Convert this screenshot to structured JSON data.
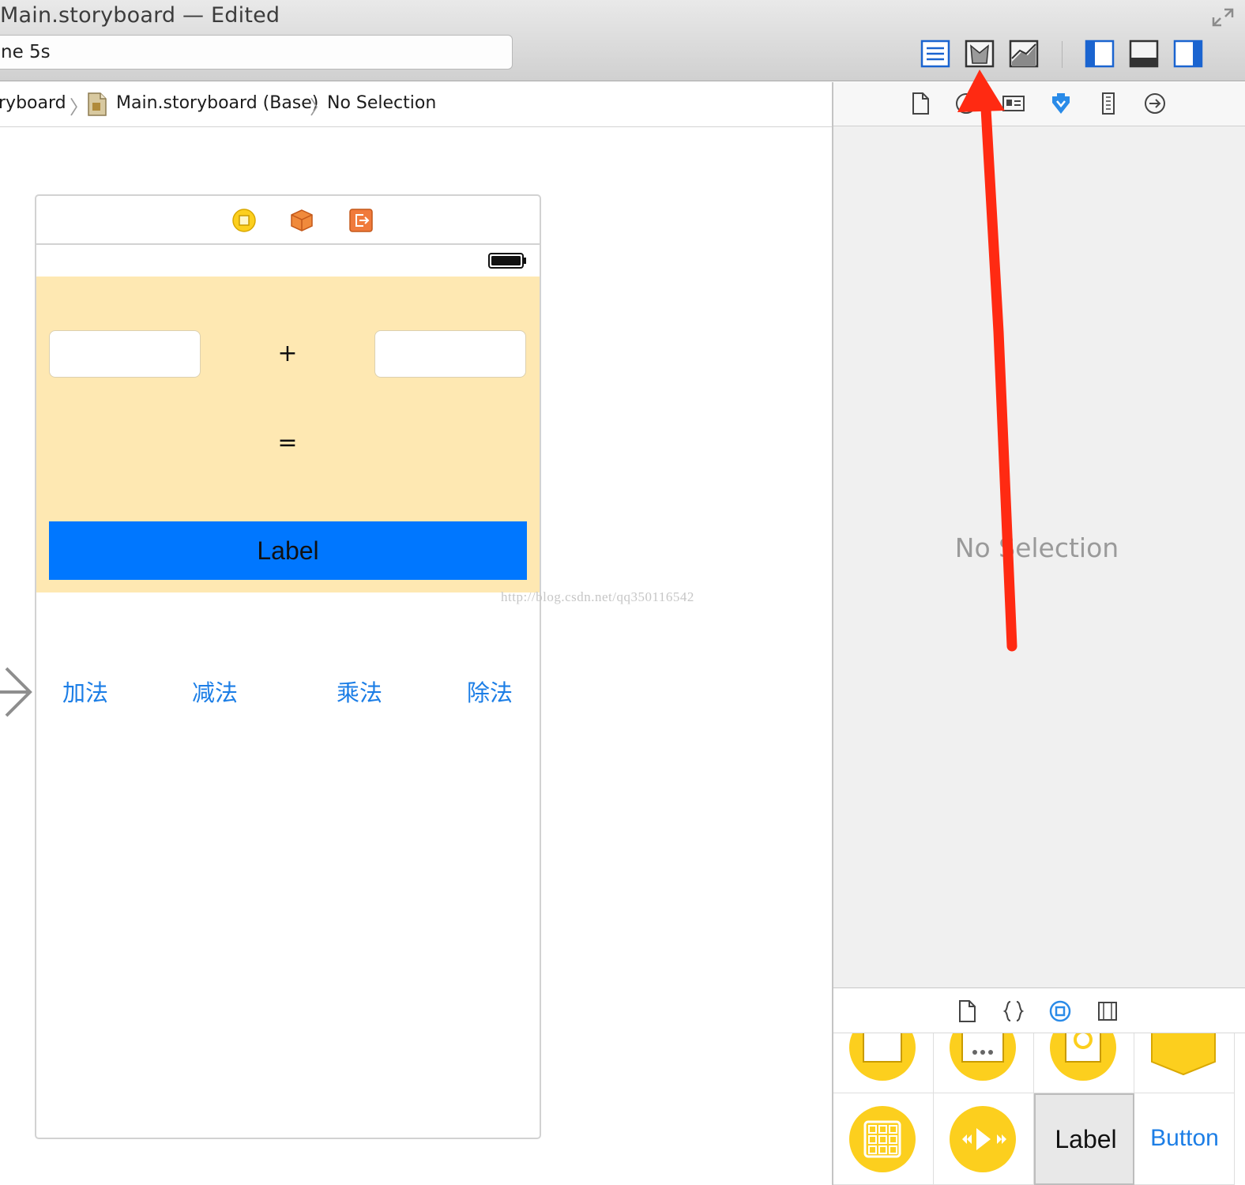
{
  "window": {
    "title": "Main.storyboard — Edited",
    "scheme": "ne 5s"
  },
  "toolbar": {
    "buttons": [
      "standard-editor-icon",
      "assistant-editor-icon",
      "version-editor-icon",
      "navigator-toggle-icon",
      "debug-area-toggle-icon",
      "utilities-toggle-icon"
    ]
  },
  "jumpbar": {
    "crumbs": [
      "ryboard",
      "Main.storyboard (Base)",
      "No Selection"
    ]
  },
  "scene": {
    "plus": "+",
    "equals": "=",
    "result_label": "Label",
    "operations": [
      "加法",
      "减法",
      "乘法",
      "除法"
    ],
    "background_color": "#fee8b2",
    "label_color": "#0077ff"
  },
  "watermark": "http://blog.csdn.net/qq350116542",
  "inspector": {
    "placeholder": "No Selection",
    "tabs": [
      "file-inspector-icon",
      "quick-help-icon",
      "identity-inspector-icon",
      "attributes-inspector-icon",
      "size-inspector-icon",
      "connections-inspector-icon"
    ]
  },
  "library": {
    "tabs": [
      "file-template-icon",
      "code-snippet-icon",
      "object-library-icon",
      "media-library-icon"
    ],
    "label_item": "Label",
    "button_item": "Button"
  },
  "colors": {
    "accent": "#1c7ee6",
    "annotation": "#ff2a12",
    "library_yellow": "#fccf1e"
  }
}
